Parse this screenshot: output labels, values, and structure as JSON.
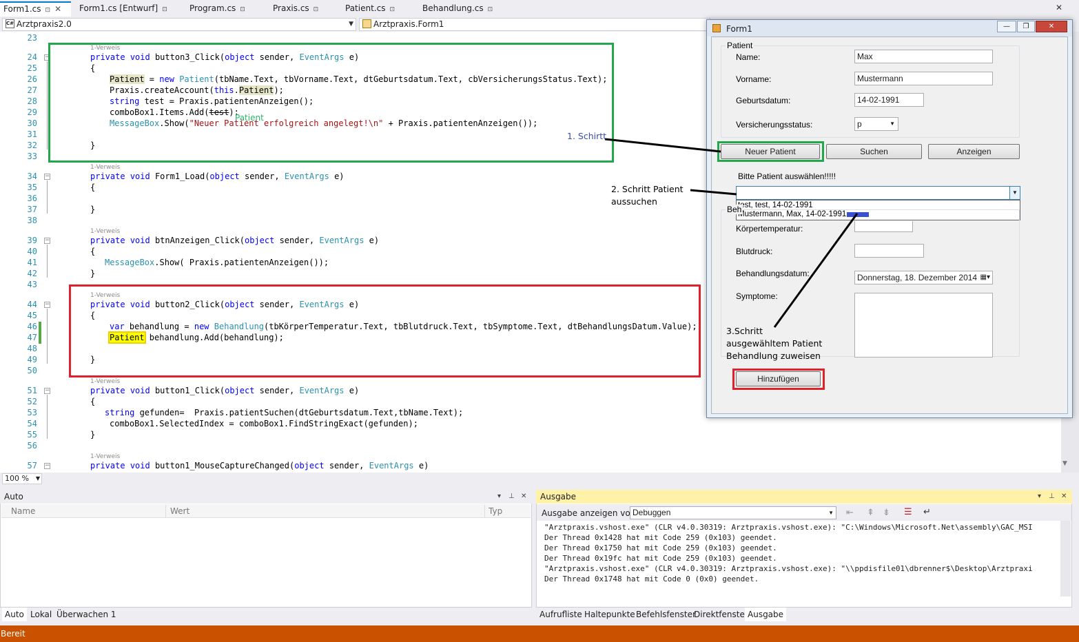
{
  "tabs": [
    {
      "label": "Form1.cs",
      "icons": "☉ ⌖ ✕"
    },
    {
      "label": "Form1.cs [Entwurf]",
      "icons": "☉"
    },
    {
      "label": "Program.cs",
      "icons": "☉"
    },
    {
      "label": "Praxis.cs",
      "icons": "☉"
    },
    {
      "label": "Patient.cs",
      "icons": "☉"
    },
    {
      "label": "Behandlung.cs",
      "icons": "☉"
    }
  ],
  "nav": {
    "project": "Arztpraxis2.0",
    "class": "Arztpraxis.Form1",
    "lang_icon": "C#"
  },
  "code": {
    "ref": "1-Verweis",
    "lines": {
      "l23": "23",
      "l24": "24",
      "l25": "25",
      "l26": "26",
      "l27": "27",
      "l28": "28",
      "l29": "29",
      "l30": "30",
      "l31": "31",
      "l32": "32",
      "l33": "33",
      "l34": "34",
      "l35": "35",
      "l36": "36",
      "l37": "37",
      "l38": "38",
      "l39": "39",
      "l40": "40",
      "l41": "41",
      "l42": "42",
      "l43": "43",
      "l44": "44",
      "l45": "45",
      "l46": "46",
      "l47": "47",
      "l48": "48",
      "l49": "49",
      "l50": "50",
      "l51": "51",
      "l52": "52",
      "l53": "53",
      "l54": "54",
      "l55": "55",
      "l56": "56",
      "l57": "57"
    },
    "tooltip_patient": "Patient",
    "t": {
      "private": "private",
      "void": "void",
      "object": "object",
      "string": "string",
      "var": "var",
      "new": "new",
      "this": "this",
      "EventArgs": "EventArgs",
      "Patient": "Patient",
      "Behandlung": "Behandlung",
      "MessageBox": "MessageBox",
      "b3": " button3_Click(",
      "sender": " sender, ",
      "e": " e)",
      "brace_o": "{",
      "brace_c": "}",
      "l26a": " = ",
      "l26b": "(tbName.Text, tbVorname.Text, dtGeburtsdatum.Text, cbVersicherungsStatus.Text);",
      "l27a": "Praxis.createAccount(",
      "l27b": ".",
      "l27c": ");",
      "l28a": " test = Praxis.patientenAnzeigen();",
      "l29a": "comboBox1.Items.Add(",
      "l29b": "test",
      "l29c": ");",
      "l30a": ".Show(",
      "l30s": "\"Neuer Patient erfolgreich angelegt!\\n\"",
      "l30b": " + Praxis.patientenAnzeigen());",
      "fl": " Form1_Load(",
      "ba": " btnAnzeigen_Click(",
      "l41b": ".Show( Praxis.patientenAnzeigen());",
      "b2": " button2_Click(",
      "l46a": " behandlung = ",
      "l46b": "(tbKörperTemperatur.Text, tbBlutdruck.Text, tbSymptome.Text, dtBehandlungsDatum.Value);",
      "l47b": " behandlung.Add(behandlung);",
      "b1": " button1_Click(",
      "l53b": " gefunden=  Praxis.patientSuchen(dtGeburtsdatum.Text,tbName.Text);",
      "l54": "comboBox1.SelectedIndex = comboBox1.FindStringExact(gefunden);",
      "b1m": " button1_MouseCaptureChanged("
    }
  },
  "zoom": "100 %",
  "form": {
    "title": "Form1",
    "group_patient": "Patient",
    "name_label": "Name:",
    "name_value": "Max",
    "vorname_label": "Vorname:",
    "vorname_value": "Mustermann",
    "geburt_label": "Geburtsdatum:",
    "geburt_value": "14-02-1991",
    "vers_label": "Versicherungsstatus:",
    "vers_value": "p",
    "btn_neu": "Neuer Patient",
    "btn_suchen": "Suchen",
    "btn_anzeigen": "Anzeigen",
    "select_label": "Bitte Patient auswählen!!!!!",
    "dropdown_items": [
      "test, test, 14-02-1991",
      "Mustermann, Max, 14-02-1991"
    ],
    "group_beh": "Beh",
    "temp_label": "Körpertemperatur:",
    "blut_label": "Blutdruck:",
    "datum_label": "Behandlungsdatum:",
    "datum_value": "Donnerstag, 18. Dezember 2014",
    "sympt_label": "Symptome:",
    "btn_hinzu": "Hinzufügen"
  },
  "annotations": {
    "s1": "1. Schirtt",
    "s2a": "2. Schritt Patient",
    "s2b": "aussuchen",
    "s3a": "3.Schritt",
    "s3b": "ausgewähltem Patient",
    "s3c": "Behandlung zuweisen"
  },
  "auto_pane": {
    "title": "Auto",
    "cols": [
      "Name",
      "Wert",
      "Typ"
    ],
    "tabs": [
      "Auto",
      "Lokal",
      "Überwachen 1"
    ]
  },
  "output_pane": {
    "title": "Ausgabe",
    "show_label": "Ausgabe anzeigen von:",
    "source": "Debuggen",
    "lines": [
      "\"Arztpraxis.vshost.exe\" (CLR v4.0.30319: Arztpraxis.vshost.exe): \"C:\\Windows\\Microsoft.Net\\assembly\\GAC_MSI",
      "Der Thread 0x1428 hat mit Code 259 (0x103) geendet.",
      "Der Thread 0x1750 hat mit Code 259 (0x103) geendet.",
      "Der Thread 0x19fc hat mit Code 259 (0x103) geendet.",
      "\"Arztpraxis.vshost.exe\" (CLR v4.0.30319: Arztpraxis.vshost.exe): \"\\\\ppdisfile01\\dbrenner$\\Desktop\\Arztpraxi",
      "Der Thread 0x1748 hat mit Code 0 (0x0) geendet."
    ],
    "tabs": [
      "Aufrufliste",
      "Haltepunkte",
      "Befehlsfenster",
      "Direktfenster",
      "Ausgabe"
    ]
  },
  "status": "Bereit",
  "colors": {
    "accent": "#007acc",
    "status": "#ca5100",
    "green_box": "#22a84a",
    "red_box": "#e0202a"
  }
}
